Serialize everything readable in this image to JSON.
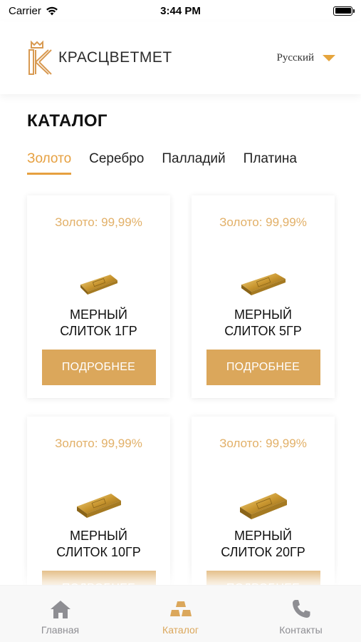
{
  "status_bar": {
    "carrier": "Carrier",
    "time": "3:44 PM"
  },
  "header": {
    "logo_text": "КРАСЦВЕТМЕТ",
    "language": "Русский"
  },
  "page": {
    "title": "КАТАЛОГ"
  },
  "tabs": [
    {
      "label": "Золото",
      "active": true
    },
    {
      "label": "Серебро",
      "active": false
    },
    {
      "label": "Палладий",
      "active": false
    },
    {
      "label": "Платина",
      "active": false
    }
  ],
  "products": [
    {
      "purity": "Золото: 99,99%",
      "name": "МЕРНЫЙ СЛИТОК 1ГР",
      "button": "ПОДРОБНЕЕ"
    },
    {
      "purity": "Золото: 99,99%",
      "name": "МЕРНЫЙ СЛИТОК 5ГР",
      "button": "ПОДРОБНЕЕ"
    },
    {
      "purity": "Золото: 99,99%",
      "name": "МЕРНЫЙ СЛИТОК 10ГР",
      "button": "ПОДРОБНЕЕ"
    },
    {
      "purity": "Золото: 99,99%",
      "name": "МЕРНЫЙ СЛИТОК 20ГР",
      "button": "ПОДРОБНЕЕ"
    }
  ],
  "tab_bar": [
    {
      "label": "Главная",
      "icon": "home-icon",
      "active": false
    },
    {
      "label": "Каталог",
      "icon": "gold-bars-icon",
      "active": true
    },
    {
      "label": "Контакты",
      "icon": "phone-icon",
      "active": false
    }
  ],
  "colors": {
    "accent": "#dba75b",
    "purity_text": "#e2b068",
    "inactive_tab": "#8e8e93"
  }
}
